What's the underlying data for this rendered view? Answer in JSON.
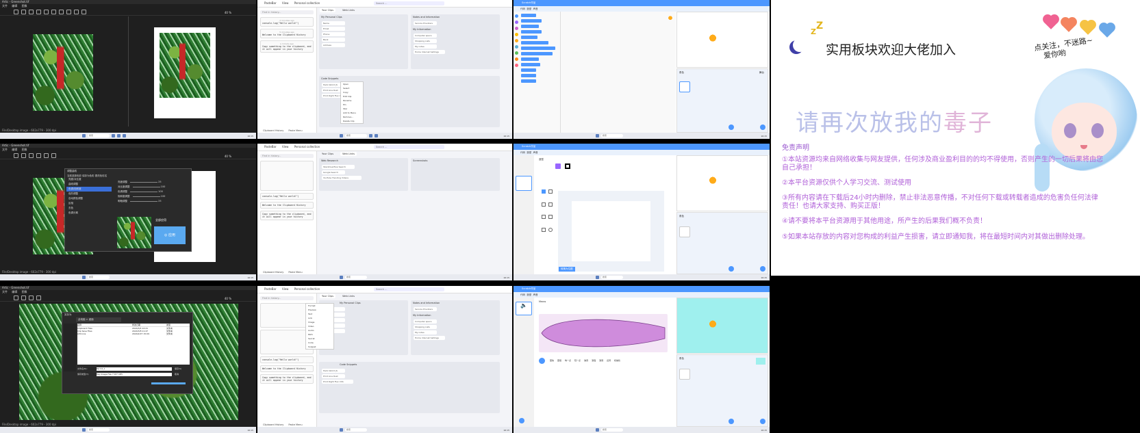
{
  "editor": {
    "title": "Artic - Greenshot.tif",
    "menu": [
      "文件",
      "编辑",
      "图像"
    ],
    "zoom": "40 %",
    "status": "File/Desktop image - 602x779 - 300 dpi",
    "adjust_dialog": {
      "title": "调整曲线",
      "header": "当前选择色彩  保存为色彩  更改色彩名",
      "items": [
        "亮度/对比度",
        "曲线调整",
        "色调/饱和度",
        "色阶调整",
        "自动颜色调整",
        "反相",
        "去色",
        "色调分离"
      ],
      "sliders": [
        {
          "label": "亮度调整",
          "value": "25"
        },
        {
          "label": "对比度调整",
          "value": "100"
        },
        {
          "label": "色调调整",
          "value": "100"
        },
        {
          "label": "饱和度调整",
          "value": "100"
        },
        {
          "label": "明暗调整",
          "value": "25"
        }
      ],
      "apply_label": "全部应用",
      "ok_label": "◎ 应用"
    },
    "save_dialog": {
      "title": "另存为",
      "path": "此电脑 > 桌面",
      "columns": [
        "名称",
        "修改日期",
        "类型"
      ],
      "files": [
        {
          "name": "Clipboard Files",
          "date": "2024/3/4 12:21",
          "type": "文件夹"
        },
        {
          "name": "Clip Save Files",
          "date": "2024/3/8 11:47",
          "type": "文件夹"
        },
        {
          "name": "ArtIcons",
          "date": "2024/2/27 15:09",
          "type": "文件夹"
        }
      ],
      "filename_label": "文件名(N):",
      "filename": "Parrot_1",
      "type_label": "保存类型(T):",
      "filetype": "Tag Image File (*.tif;*.tiff)",
      "save_label": "保存(S)",
      "cancel_label": "取消"
    }
  },
  "clipboard": {
    "app_name": "PasteBar",
    "view_label": "View",
    "collection": "Personal collection",
    "search_placeholder": "Search ...",
    "help": "Help",
    "filter_placeholder": "Find in history...",
    "history": [
      {
        "ts": "2 minutes ago",
        "text": "console.log(\"Hello world!\")"
      },
      {
        "ts": "5 minutes ago",
        "text": "Welcome to the Clipboard History"
      },
      {
        "ts": "a minute ago",
        "text": "Copy something to the clipboard, and it will appear in your history"
      }
    ],
    "footer": [
      "Clipboard History",
      "Paste Menu"
    ],
    "tabs": [
      "Your Clips",
      "Web Links"
    ],
    "personal_clips": {
      "title": "My Personal Clips",
      "items": [
        "Name",
        "Email",
        "Phone",
        "Bank",
        "Address"
      ]
    },
    "notes": {
      "title": "Notes and Information",
      "sub": "My Information",
      "first": "Service Providers",
      "items": [
        "Computer specs",
        "Shopping Lists",
        "My notes",
        "Home Internet Settings"
      ]
    },
    "snippets": {
      "title": "Code Snippets",
      "items": [
        "Hello World JS",
        "Print Line Rust",
        "Print Right Flex CSS"
      ]
    },
    "context_menu": [
      "Open",
      "Select",
      "Copy",
      "Edit Clip",
      "Rename",
      "Pin",
      "Star",
      "Add to Menu",
      "Remove...",
      "Delete Clip"
    ],
    "web_research": {
      "title": "Web Research",
      "items": [
        "StackOverflow Search",
        "Google Search",
        "YouTube Trending Videos"
      ]
    },
    "screenshots": "Screenshots",
    "insert_menu": [
      "Format",
      "Preview",
      "Text",
      "Link",
      "Image",
      "Video",
      "Audio",
      "Path",
      "Secret",
      "Code",
      "Snippet"
    ]
  },
  "scratch": {
    "title": "Scratch 3.0",
    "tabs": [
      "代码",
      "造型",
      "声音"
    ],
    "project": "Scratch作品",
    "brush_label": "造型",
    "convert_label": "转换为位图",
    "sound_name": "Meow",
    "sound_controls": [
      "更快",
      "更慢",
      "响一点",
      "轻一点",
      "静音",
      "渐强",
      "渐弱",
      "反转",
      "机械化"
    ],
    "sprite_label": "角色",
    "sprite_name": "Sprite1",
    "stage_label": "舞台"
  },
  "poster": {
    "title": "实用板块欢迎大佬加入",
    "faded": "请再次放我的",
    "faded_highlight": "毒子",
    "note_lines": [
      "点关注，不迷路~",
      "爱你哟"
    ],
    "disclaimer_title": "免责声明",
    "disclaimer": [
      "①本站资源均来自网络收集与网友提供，任何涉及商业盈利目的的均不得使用，否则产生的一切后果将由您自己承担！",
      "②本平台资源仅供个人学习交流、测试使用",
      "③所有内容请在下载后24小时内删除，禁止非法恶意传播，不对任何下载或转载者造成的危害负任何法律责任！也请大家支持、购买正版！",
      "④请不要将本平台资源用于其他用途，所产生的后果我们概不负责！",
      "⑤如果本站存放的内容对您构成的利益产生损害，请立即通知我，将在最短时间内对其做出删除处理。"
    ],
    "colors": {
      "hearts": [
        "#f06292",
        "#f4845f",
        "#f6c344",
        "#6aa8e8"
      ]
    }
  },
  "taskbar": {
    "search": "搜索",
    "time": "16:15",
    "date": "2024/3/8"
  }
}
